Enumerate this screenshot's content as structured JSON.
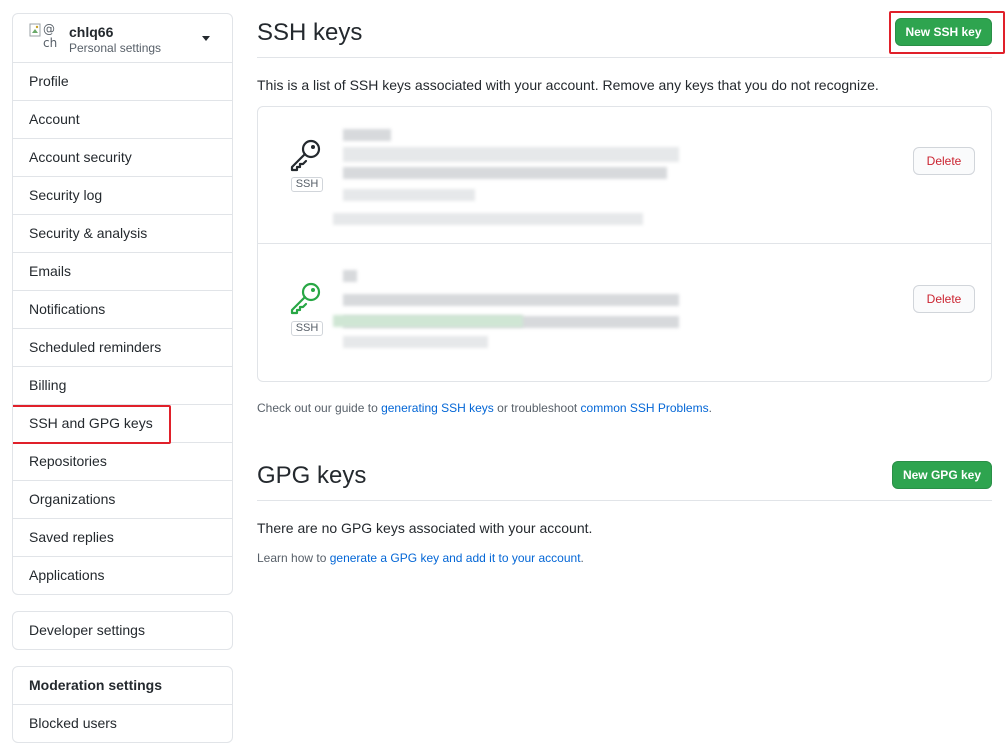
{
  "user": {
    "avatar_alt": "@ch",
    "avatar_alt_line1": "@",
    "avatar_alt_line2": "ch",
    "username": "chlq66",
    "subtitle": "Personal settings"
  },
  "sidebar": {
    "items": [
      {
        "label": "Profile"
      },
      {
        "label": "Account"
      },
      {
        "label": "Account security"
      },
      {
        "label": "Security log"
      },
      {
        "label": "Security & analysis"
      },
      {
        "label": "Emails"
      },
      {
        "label": "Notifications"
      },
      {
        "label": "Scheduled reminders"
      },
      {
        "label": "Billing"
      },
      {
        "label": "SSH and GPG keys",
        "highlighted": true
      },
      {
        "label": "Repositories"
      },
      {
        "label": "Organizations"
      },
      {
        "label": "Saved replies"
      },
      {
        "label": "Applications"
      }
    ],
    "developer_settings": "Developer settings",
    "moderation": {
      "heading": "Moderation settings",
      "items": [
        {
          "label": "Blocked users"
        }
      ]
    }
  },
  "ssh": {
    "title": "SSH keys",
    "new_button": "New SSH key",
    "description": "This is a list of SSH keys associated with your account. Remove any keys that you do not recognize.",
    "keys": [
      {
        "badge": "SSH",
        "icon": "key-icon",
        "icon_color": "#24292e",
        "delete_label": "Delete"
      },
      {
        "badge": "SSH",
        "icon": "key-icon",
        "icon_color": "#28a745",
        "delete_label": "Delete"
      }
    ],
    "guide": {
      "prefix": "Check out our guide to ",
      "link1": "generating SSH keys",
      "middle": " or troubleshoot ",
      "link2": "common SSH Problems",
      "suffix": "."
    }
  },
  "gpg": {
    "title": "GPG keys",
    "new_button": "New GPG key",
    "empty_text": "There are no GPG keys associated with your account.",
    "learn": {
      "prefix": "Learn how to ",
      "link": "generate a GPG key and add it to your account",
      "suffix": "."
    }
  },
  "colors": {
    "primary_green": "#2ea44f",
    "danger_red": "#cb2431",
    "link_blue": "#0366d6",
    "annotation_red": "#e0202a"
  }
}
